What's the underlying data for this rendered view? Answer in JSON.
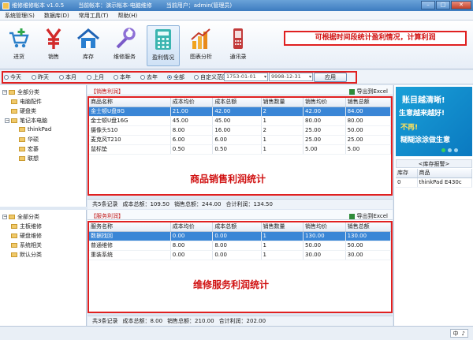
{
  "titlebar": {
    "app": "维修维修帐本 v1.0.5",
    "account": "当前帐本：演示帐本-电脑维修",
    "user": "当前用户：admin(管理员)"
  },
  "menu": [
    "系统管理(S)",
    "数据库(D)",
    "常用工具(T)",
    "帮助(H)"
  ],
  "toolbar": [
    {
      "label": "进货",
      "icon": "cart-plus-icon"
    },
    {
      "label": "销售",
      "icon": "yen-icon"
    },
    {
      "label": "库存",
      "icon": "house-icon"
    },
    {
      "label": "维修服务",
      "icon": "wrench-icon"
    },
    {
      "label": "盈利情况",
      "icon": "calculator-icon"
    },
    {
      "label": "图表分析",
      "icon": "bar-chart-icon"
    },
    {
      "label": "通讯录",
      "icon": "phone-icon"
    }
  ],
  "callout": "可根据时间段统计盈利情况，计算利润",
  "filter": {
    "options": [
      "今天",
      "昨天",
      "本月",
      "上月",
      "本年",
      "去年",
      "全部",
      "自定义范围"
    ],
    "selected": "全部",
    "date_from": "1753-01-01",
    "date_to": "9998-12-31",
    "apply": "应用"
  },
  "goods_tree": [
    {
      "label": "全部分类",
      "level": 0
    },
    {
      "label": "电脑配件",
      "level": 1
    },
    {
      "label": "硬盘类",
      "level": 1
    },
    {
      "label": "笔记本电脑",
      "level": 1
    },
    {
      "label": "thinkPad",
      "level": 2
    },
    {
      "label": "华硕",
      "level": 2
    },
    {
      "label": "宏碁",
      "level": 2
    },
    {
      "label": "联想",
      "level": 2
    }
  ],
  "sales": {
    "title": "【销售利润】",
    "export": "导出到Excel",
    "columns": [
      "商品名称",
      "成本均价",
      "成本总额",
      "销售数量",
      "销售均价",
      "销售总额"
    ],
    "rows": [
      [
        "金士顿U盘8G",
        "21.00",
        "42.00",
        "2",
        "42.00",
        "84.00"
      ],
      [
        "金士顿U盘16G",
        "45.00",
        "45.00",
        "1",
        "80.00",
        "80.00"
      ],
      [
        "摄像头S10",
        "8.00",
        "16.00",
        "2",
        "25.00",
        "50.00"
      ],
      [
        "麦克风T210",
        "6.00",
        "6.00",
        "1",
        "25.00",
        "25.00"
      ],
      [
        "鼠标垫",
        "0.50",
        "0.50",
        "1",
        "5.00",
        "5.00"
      ]
    ],
    "big_label": "商品销售利润统计",
    "summary": {
      "count": "共5条记录",
      "cost": "成本总额：109.50",
      "sales": "销售总额：244.00",
      "profit": "合计利润：134.50"
    }
  },
  "service_tree": [
    {
      "label": "全部分类",
      "level": 0
    },
    {
      "label": "主板维修",
      "level": 1
    },
    {
      "label": "硬盘维修",
      "level": 1
    },
    {
      "label": "系统相关",
      "level": 1
    },
    {
      "label": "默认分类",
      "level": 1
    }
  ],
  "service": {
    "title": "【服务利润】",
    "export": "导出到Excel",
    "columns": [
      "服务名称",
      "成本均价",
      "成本总额",
      "销售数量",
      "销售均价",
      "销售总额"
    ],
    "rows": [
      [
        "数据找回",
        "0.00",
        "0.00",
        "1",
        "130.00",
        "130.00"
      ],
      [
        "普通维修",
        "8.00",
        "8.00",
        "1",
        "50.00",
        "50.00"
      ],
      [
        "重装系统",
        "0.00",
        "0.00",
        "1",
        "30.00",
        "30.00"
      ]
    ],
    "big_label": "维修服务利润统计",
    "summary": {
      "count": "共3条记录",
      "cost": "成本总额：8.00",
      "sales": "销售总额：210.00",
      "profit": "合计利润：202.00"
    }
  },
  "ad": {
    "l1": "账目越清晰!",
    "l2": "生意越来越好!",
    "l3": "不再!",
    "l4": "糊糊涂涂做生意"
  },
  "stock_alert": {
    "title": "<库存报警>",
    "columns": [
      "库存",
      "商品"
    ],
    "rows": [
      [
        "0",
        "thinkPad E430c"
      ]
    ]
  },
  "ime": {
    "lang": "中",
    "glyph": "♪"
  },
  "colors": {
    "accent": "#3a86d6",
    "highlight_red": "#e02020"
  }
}
